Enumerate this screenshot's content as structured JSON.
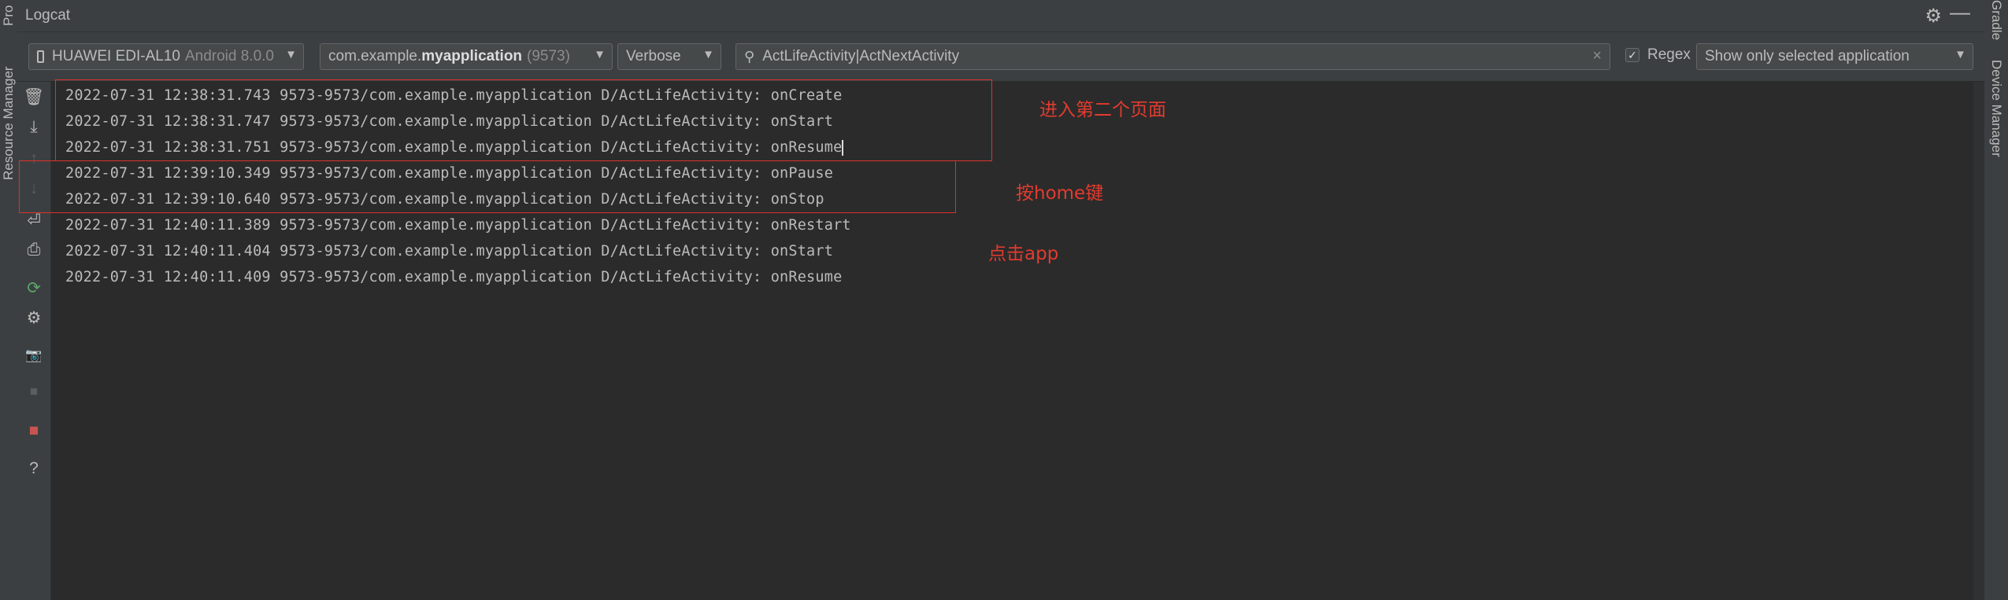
{
  "window": {
    "title": "Logcat",
    "left_tabs": [
      "Pro",
      "Resource Manager"
    ],
    "right_tabs": [
      "Gradle",
      "Device Manager"
    ]
  },
  "toolbar": {
    "device": {
      "name": "HUAWEI EDI-AL10",
      "os": "Android 8.0.0"
    },
    "process": {
      "prefix": "com.example.",
      "bold": "myapplication",
      "pid": "(9573)"
    },
    "level": "Verbose",
    "search": {
      "value": "ActLifeActivity|ActNextActivity",
      "clear_icon": "×"
    },
    "regex": {
      "label": "Regex",
      "checked": true
    },
    "filter": "Show only selected application"
  },
  "actions": [
    {
      "name": "clear-logcat-icon",
      "glyph": "🗑"
    },
    {
      "name": "scroll-to-end-icon",
      "glyph": "⤓"
    },
    {
      "name": "up-the-stack-icon",
      "glyph": "↑"
    },
    {
      "name": "down-the-stack-icon",
      "glyph": "↓"
    },
    {
      "name": "soft-wraps-icon",
      "glyph": "⏎"
    },
    {
      "name": "print-icon",
      "glyph": "⎙"
    },
    {
      "name": "restart-icon",
      "glyph": "⟳"
    },
    {
      "name": "settings-icon",
      "glyph": "⚙"
    },
    {
      "name": "screen-capture-icon",
      "glyph": "📷"
    },
    {
      "name": "screen-record-icon",
      "glyph": "■"
    },
    {
      "name": "stop-icon",
      "glyph": "■"
    },
    {
      "name": "help-icon",
      "glyph": "?"
    }
  ],
  "log": [
    "2022-07-31 12:38:31.743 9573-9573/com.example.myapplication D/ActLifeActivity: onCreate",
    "2022-07-31 12:38:31.747 9573-9573/com.example.myapplication D/ActLifeActivity: onStart",
    "2022-07-31 12:38:31.751 9573-9573/com.example.myapplication D/ActLifeActivity: onResume",
    "2022-07-31 12:39:10.349 9573-9573/com.example.myapplication D/ActLifeActivity: onPause",
    "2022-07-31 12:39:10.640 9573-9573/com.example.myapplication D/ActLifeActivity: onStop",
    "2022-07-31 12:40:11.389 9573-9573/com.example.myapplication D/ActLifeActivity: onRestart",
    "2022-07-31 12:40:11.404 9573-9573/com.example.myapplication D/ActLifeActivity: onStart",
    "2022-07-31 12:40:11.409 9573-9573/com.example.myapplication D/ActLifeActivity: onResume"
  ],
  "annotations": {
    "enter_second_page": "进入第二个页面",
    "press_home": "按home键",
    "click_app": "点击app"
  },
  "colors": {
    "annotation": "#e23b2f",
    "background": "#2b2b2b",
    "panel": "#3c3f41"
  }
}
